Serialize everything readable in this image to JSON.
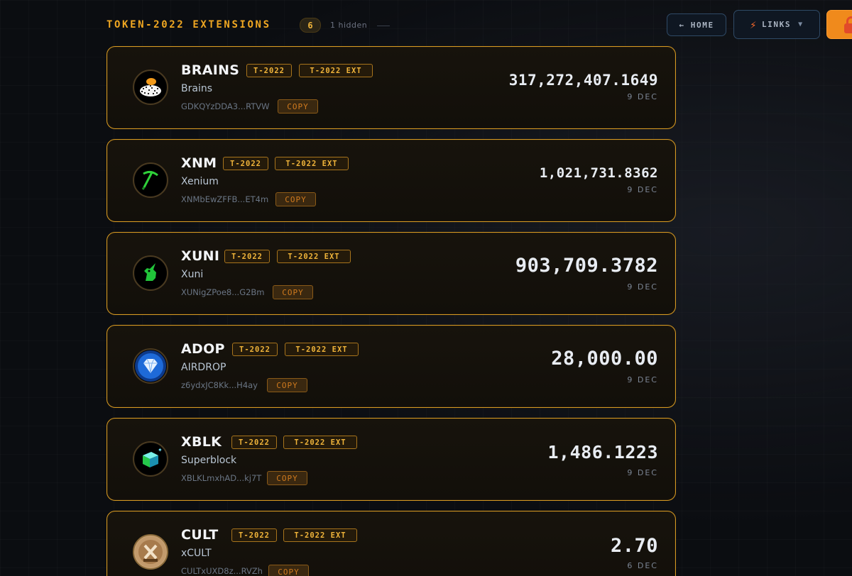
{
  "header": {
    "title": "TOKEN-2022 EXTENSIONS",
    "count": "6",
    "hidden_note": "1 hidden",
    "home_label": "← HOME",
    "links_label": "LINKS",
    "links_icon": "lightning-bolt-icon",
    "orange_icon": "lock-icon"
  },
  "colors": {
    "accent": "#f0a722",
    "card_border": "#d79a22",
    "background": "#0b0d11"
  },
  "tokens": [
    {
      "symbol": "BRAINS",
      "tag1": "T-2022",
      "tag2": "T-2022 EXT",
      "name": "Brains",
      "address": "GDKQYzDDA3...RTVW",
      "copy": "COPY",
      "balance": "317,272,407.1649",
      "date": "9 DEC",
      "icon": "brains-logo-icon"
    },
    {
      "symbol": "XNM",
      "tag1": "T-2022",
      "tag2": "T-2022 EXT",
      "name": "Xenium",
      "address": "XNMbEwZFFB...ET4m",
      "copy": "COPY",
      "balance": "1,021,731.8362",
      "date": "9 DEC",
      "icon": "pickaxe-icon"
    },
    {
      "symbol": "XUNI",
      "tag1": "T-2022",
      "tag2": "T-2022 EXT",
      "name": "Xuni",
      "address": "XUNigZPoe8...G2Bm",
      "copy": "COPY",
      "balance": "903,709.3782",
      "date": "9 DEC",
      "icon": "unicorn-icon"
    },
    {
      "symbol": "ADOP",
      "tag1": "T-2022",
      "tag2": "T-2022 EXT",
      "name": "AIRDROP",
      "address": "z6ydxJC8Kk...H4ay",
      "copy": "COPY",
      "balance": "28,000.00",
      "date": "9 DEC",
      "icon": "diamond-icon"
    },
    {
      "symbol": "XBLK",
      "tag1": "T-2022",
      "tag2": "T-2022 EXT",
      "name": "Superblock",
      "address": "XBLKLmxhAD...kj7T",
      "copy": "COPY",
      "balance": "1,486.1223",
      "date": "9 DEC",
      "icon": "cube-icon"
    },
    {
      "symbol": "CULT",
      "tag1": "T-2022",
      "tag2": "T-2022 EXT",
      "name": "xCULT",
      "address": "CULTxUXD8z...RVZh",
      "copy": "COPY",
      "balance": "2.70",
      "date": "6 DEC",
      "icon": "xcult-coin-icon"
    }
  ]
}
